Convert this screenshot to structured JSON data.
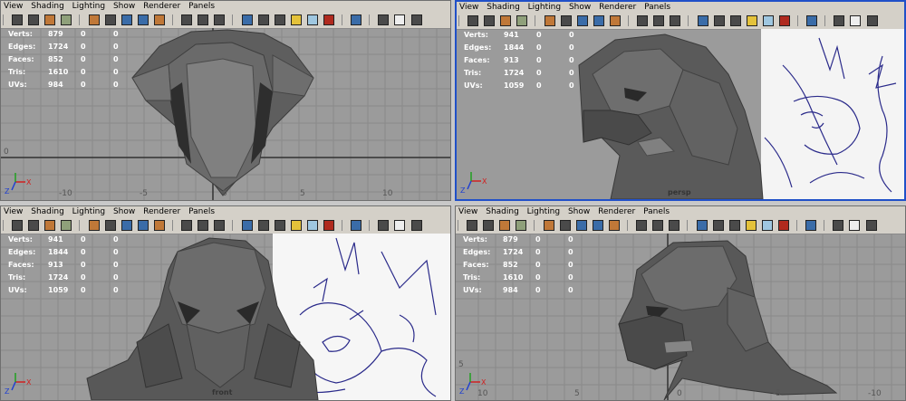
{
  "menu": [
    "View",
    "Shading",
    "Lighting",
    "Show",
    "Renderer",
    "Panels"
  ],
  "hud_labels": [
    "Verts:",
    "Edges:",
    "Faces:",
    "Tris:",
    "UVs:"
  ],
  "viewports": [
    {
      "id": "top",
      "active": false,
      "camera": "",
      "stats": [
        [
          "879",
          "0",
          "0"
        ],
        [
          "1724",
          "0",
          "0"
        ],
        [
          "852",
          "0",
          "0"
        ],
        [
          "1610",
          "0",
          "0"
        ],
        [
          "984",
          "0",
          "0"
        ]
      ],
      "ticks": [
        "-10",
        "-5",
        "0",
        "5",
        "10",
        "0"
      ]
    },
    {
      "id": "persp",
      "active": true,
      "camera": "persp",
      "stats": [
        [
          "941",
          "0",
          "0"
        ],
        [
          "1844",
          "0",
          "0"
        ],
        [
          "913",
          "0",
          "0"
        ],
        [
          "1724",
          "0",
          "0"
        ],
        [
          "1059",
          "0",
          "0"
        ]
      ],
      "ticks": []
    },
    {
      "id": "front",
      "active": false,
      "camera": "front",
      "stats": [
        [
          "941",
          "0",
          "0"
        ],
        [
          "1844",
          "0",
          "0"
        ],
        [
          "913",
          "0",
          "0"
        ],
        [
          "1724",
          "0",
          "0"
        ],
        [
          "1059",
          "0",
          "0"
        ]
      ],
      "ticks": []
    },
    {
      "id": "side",
      "active": false,
      "camera": "",
      "stats": [
        [
          "879",
          "0",
          "0"
        ],
        [
          "1724",
          "0",
          "0"
        ],
        [
          "852",
          "0",
          "0"
        ],
        [
          "1610",
          "0",
          "0"
        ],
        [
          "984",
          "0",
          "0"
        ]
      ],
      "ticks": [
        "10",
        "5",
        "0",
        "-5",
        "-10",
        "5"
      ]
    }
  ],
  "axis_letters": {
    "x": "X",
    "y": "Y",
    "z": "Z"
  },
  "colors": {
    "accent_active": "#2050c8",
    "grid": "#8a8a8a",
    "mesh": "#5a5a5a",
    "sketch": "#2a2a8a"
  }
}
